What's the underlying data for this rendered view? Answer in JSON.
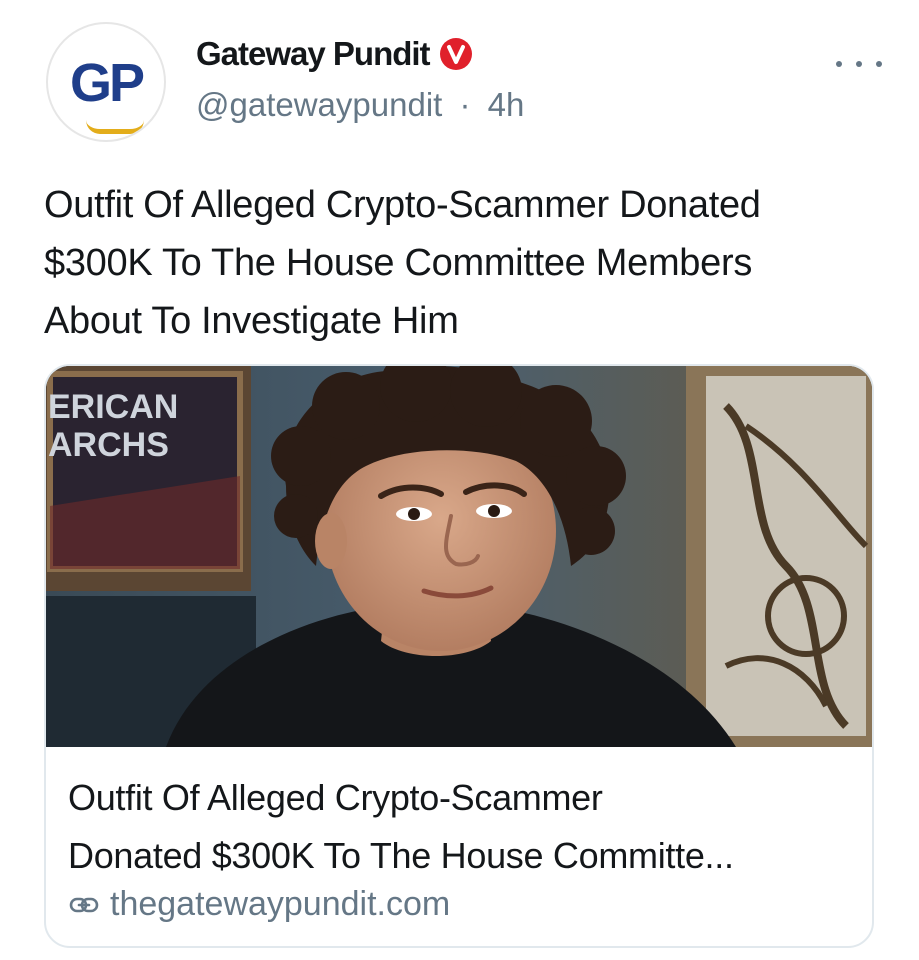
{
  "post": {
    "author": {
      "avatar_text": "GP",
      "name": "Gateway Pundit",
      "verified_badge": "V",
      "handle": "@gatewaypundit",
      "separator": "·",
      "time": "4h"
    },
    "more_icon": "more-horizontal-icon",
    "text_lines": [
      "Outfit Of Alleged Crypto-Scammer Donated",
      "$300K To The House Committee Members",
      "About To Investigate Him"
    ]
  },
  "card": {
    "image_description_text": "ERICAN\nARCHS",
    "image_sign_line1": "ERICAN",
    "image_sign_line2": "ARCHS",
    "title_lines": [
      "Outfit Of Alleged Crypto-Scammer",
      "Donated $300K To The House Committe..."
    ],
    "link_icon": "link-icon",
    "domain": "thegatewaypundit.com"
  },
  "colors": {
    "badge_red": "#e0202b",
    "avatar_blue": "#1f3e8a",
    "avatar_gold": "#e3ad1b",
    "secondary_text": "#657786",
    "primary_text": "#14171a",
    "card_border": "#e1e8ed"
  }
}
